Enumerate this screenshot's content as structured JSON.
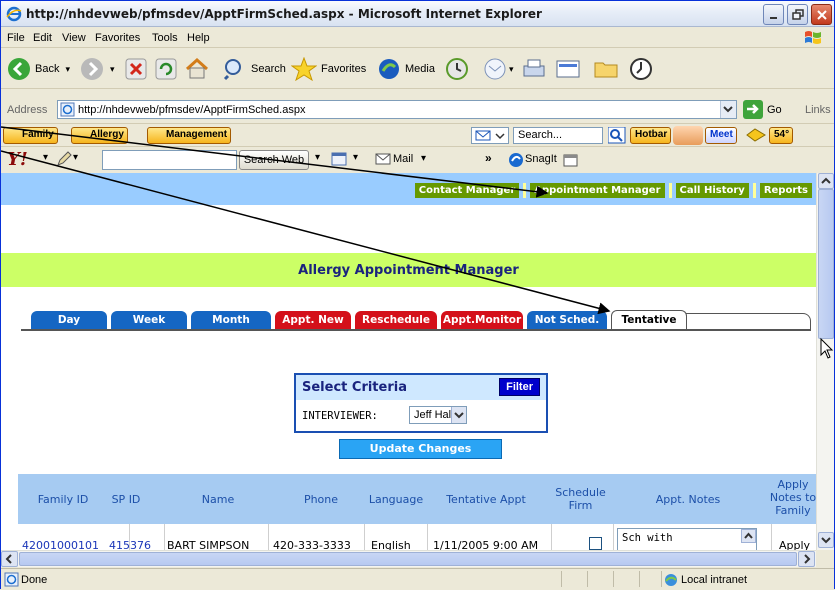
{
  "window": {
    "title": "http://nhdevweb/pfmsdev/ApptFirmSched.aspx - Microsoft Internet Explorer"
  },
  "menu": [
    "File",
    "Edit",
    "View",
    "Favorites",
    "Tools",
    "Help"
  ],
  "toolbar": {
    "back": "Back",
    "search": "Search",
    "favorites": "Favorites",
    "media": "Media"
  },
  "address": {
    "label": "Address",
    "url": "http://nhdevweb/pfmsdev/ApptFirmSched.aspx",
    "go": "Go",
    "links": "Links"
  },
  "bar2": {
    "family": "Family",
    "allergy": "Allergy",
    "management": "Management",
    "search_placeholder": "Search...",
    "hotbar": "Hotbar",
    "meet": "Meet",
    "temp": "54°"
  },
  "bar3": {
    "search_web": "Search Web",
    "mail": "Mail",
    "snagit": "SnagIt",
    "more": "»"
  },
  "nav": {
    "links": [
      "Contact Manager",
      "Appointment Manager",
      "Call History",
      "Reports"
    ]
  },
  "page": {
    "title": "Allergy Appointment Manager"
  },
  "tabs": [
    {
      "label": "Day",
      "color": "#1566c3"
    },
    {
      "label": "Week",
      "color": "#1566c3"
    },
    {
      "label": "Month",
      "color": "#1566c3"
    },
    {
      "label": "Appt. New",
      "color": "#d4101a"
    },
    {
      "label": "Reschedule",
      "color": "#d4101a"
    },
    {
      "label": "Appt.Monitor",
      "color": "#d4101a"
    },
    {
      "label": "Not Sched.",
      "color": "#1566c3"
    },
    {
      "label": "Tentative",
      "color": "#ffffff"
    }
  ],
  "criteria": {
    "title": "Select Criteria",
    "filter": "Filter",
    "interviewer_label": "INTERVIEWER:",
    "interviewer_value": "Jeff Hall"
  },
  "update_button": "Update Changes",
  "table": {
    "headers": [
      "Family ID",
      "SP ID",
      "Name",
      "Phone",
      "Language",
      "Tentative Appt",
      "Schedule Firm",
      "Appt. Notes",
      "Apply Notes to Family"
    ],
    "rows": [
      {
        "family_id": "42001000101",
        "sp_id": "415376",
        "name": "BART SIMPSON",
        "phone": "420-333-3333",
        "language": "English",
        "tentative": "1/11/2005 9:00 AM",
        "notes": "Sch with",
        "apply": "Apply"
      }
    ]
  },
  "status": {
    "text": "Done",
    "zone": "Local intranet"
  }
}
